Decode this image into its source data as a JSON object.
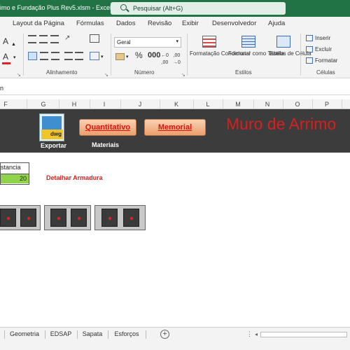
{
  "window": {
    "title": "imo e Fundação Plus Rev5.xlsm  -  Excel",
    "search_placeholder": "Pesquisar (Alt+G)"
  },
  "ribbon_tabs": [
    "Layout da Página",
    "Fórmulas",
    "Dados",
    "Revisão",
    "Exibir",
    "Desenvolvedor",
    "Ajuda"
  ],
  "ribbon": {
    "font_size_partial": "A",
    "alignment_group": "Alinhamento",
    "number_group": "Número",
    "number_format": "Geral",
    "styles_group": "Estilos",
    "cells_group": "Células",
    "cond_format": "Formatação Condicional",
    "format_table": "Formatar como Tabela",
    "cell_styles": "Estilos de Célula",
    "insert": "Inserir",
    "delete": "Excluir",
    "format": "Formatar"
  },
  "formula_bar": {
    "value": "n"
  },
  "columns": [
    "F",
    "G",
    "H",
    "I",
    "J",
    "K",
    "L",
    "M",
    "N",
    "O",
    "P"
  ],
  "sheet_content": {
    "logo_text": "dwg",
    "export_label": "Exportar",
    "btn_quantitativo": "Quantitativo",
    "btn_memorial": "Memorial",
    "materials_label": "Materiais",
    "big_title": "Muro de Arrimo",
    "distancia_header": "stancia",
    "distancia_value": "20",
    "detail_link": "Detalhar Armadura"
  },
  "sheet_tabs": [
    "Geometria",
    "EDSAP",
    "Sapata",
    "Esforços"
  ],
  "colors": {
    "excel_green": "#217346",
    "band_bg": "#3c3c3c",
    "title_red": "#d81f1f",
    "value_green": "#8fd34a"
  }
}
